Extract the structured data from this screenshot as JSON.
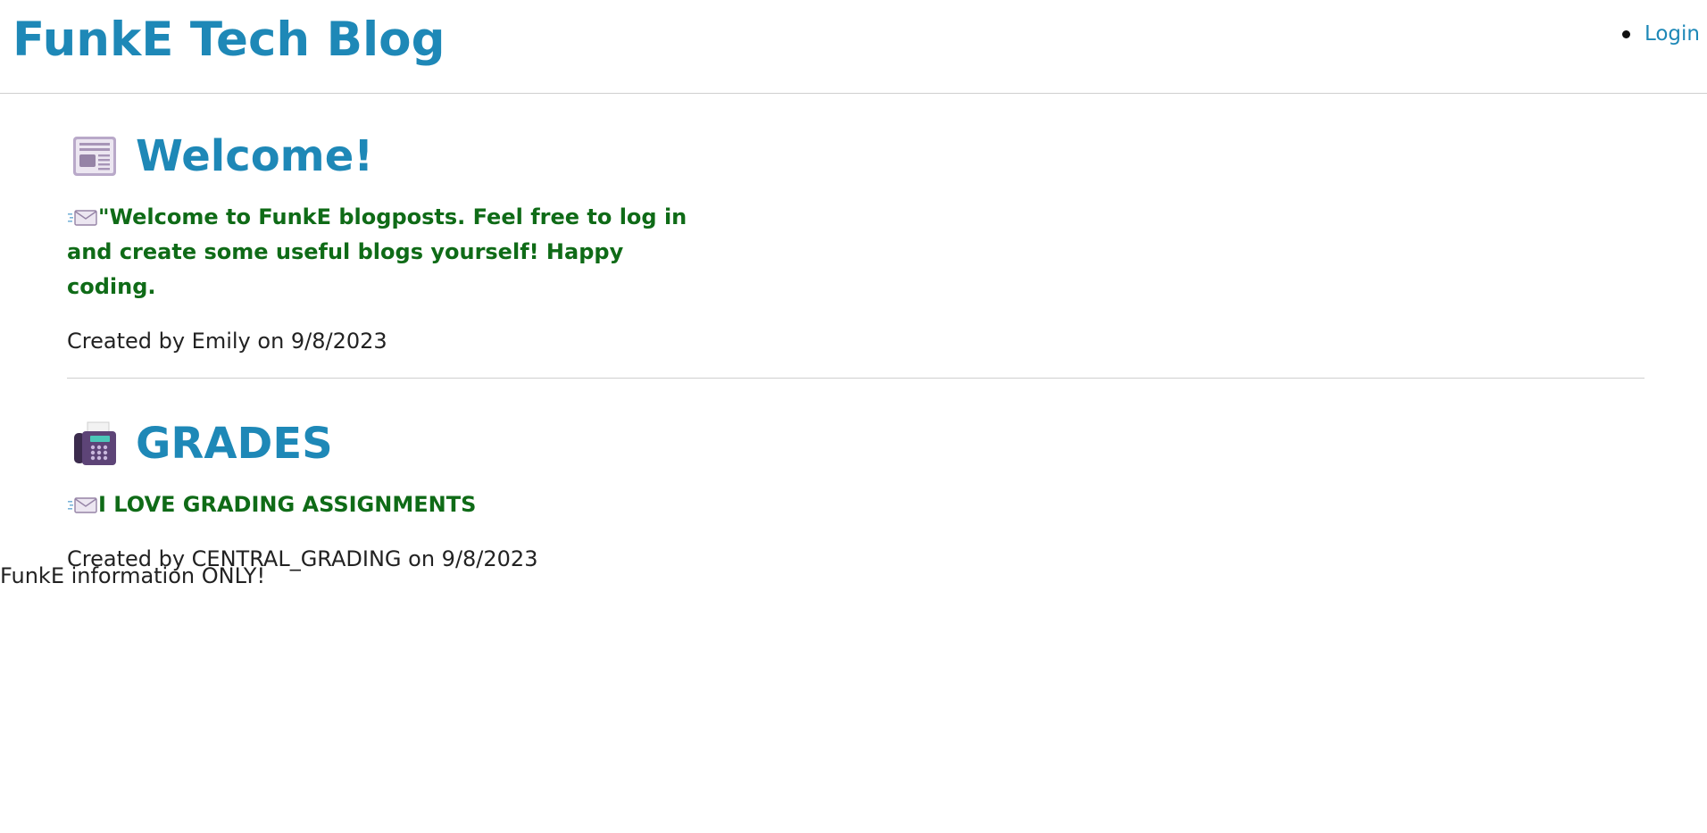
{
  "header": {
    "title": "FunkE Tech Blog",
    "nav": {
      "login_label": "Login"
    }
  },
  "posts": [
    {
      "icon": "newspaper-icon",
      "title": "Welcome!",
      "content_icon": "incoming-envelope-icon",
      "content": "\"Welcome to FunkE blogposts. Feel free to log in and create some useful blogs yourself! Happy coding.",
      "meta": "Created by Emily on 9/8/2023"
    },
    {
      "icon": "fax-machine-icon",
      "title": "GRADES",
      "content_icon": "incoming-envelope-icon",
      "content": "I LOVE GRADING ASSIGNMENTS",
      "meta": "Created by CENTRAL_GRADING on 9/8/2023"
    }
  ],
  "footer": {
    "text": "FunkE information ONLY!"
  },
  "colors": {
    "accent": "#1e88b7",
    "post_body": "#0f6b17",
    "divider": "#cfcfcf"
  }
}
